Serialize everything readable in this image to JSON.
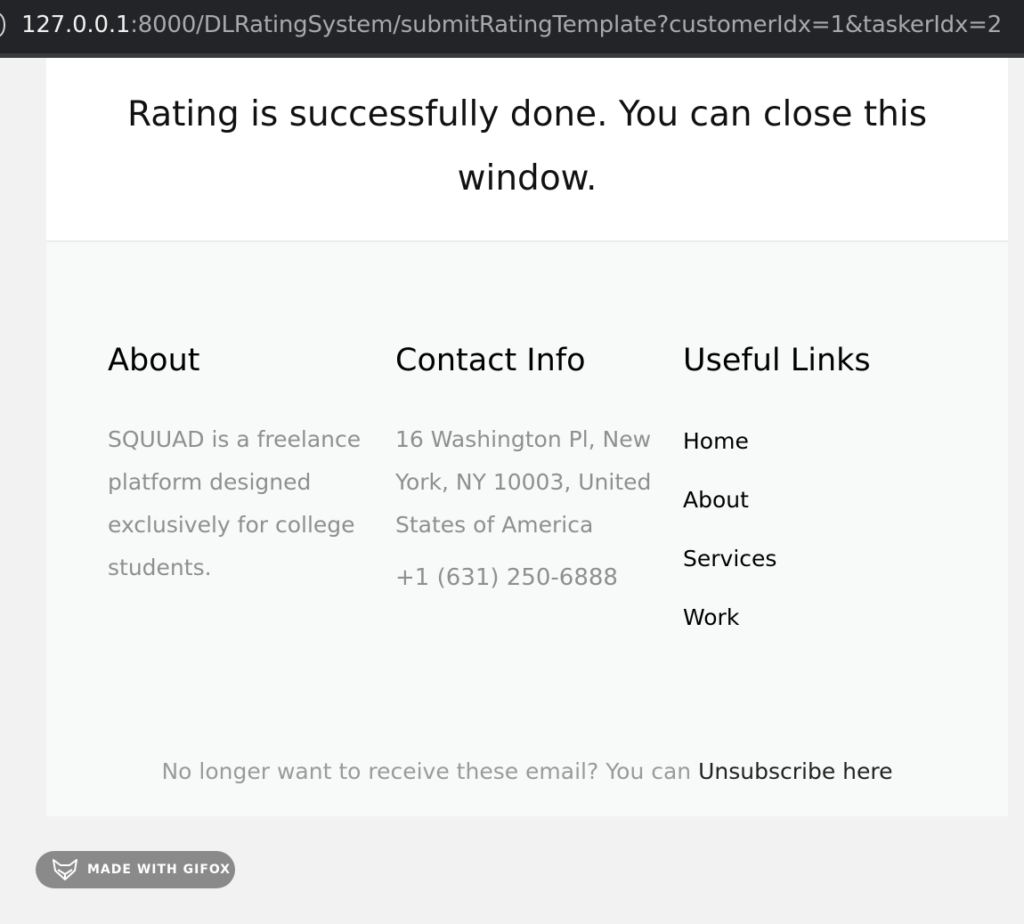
{
  "browser": {
    "url_host": "127.0.0.1",
    "url_rest": ":8000/DLRatingSystem/submitRatingTemplate?customerIdx=1&taskerIdx=2"
  },
  "confirmation": {
    "message": "Rating is successfully done. You can close this window."
  },
  "footer": {
    "about": {
      "heading": "About",
      "text": "SQUUAD is a freelance platform designed exclusively for college students."
    },
    "contact": {
      "heading": "Contact Info",
      "address": "16 Washington Pl, New York, NY 10003, United States of America",
      "phone": "+1 (631) 250-6888"
    },
    "links": {
      "heading": "Useful Links",
      "items": [
        "Home",
        "About",
        "Services",
        "Work"
      ]
    },
    "unsubscribe": {
      "prefix": "No longer want to receive these email? You can",
      "link_label": "Unsubscribe here"
    }
  },
  "badge": {
    "icon": "fox-icon",
    "label": "MADE WITH GIFOX"
  }
}
